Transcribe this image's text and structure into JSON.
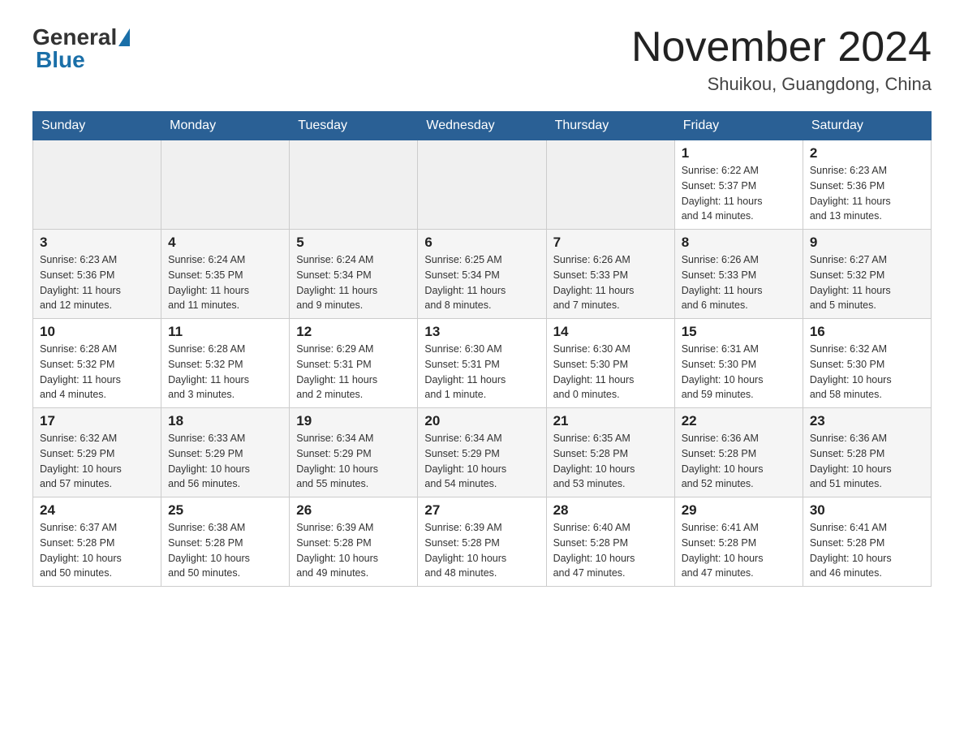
{
  "header": {
    "logo_general": "General",
    "logo_blue": "Blue",
    "month_title": "November 2024",
    "location": "Shuikou, Guangdong, China"
  },
  "days_of_week": [
    "Sunday",
    "Monday",
    "Tuesday",
    "Wednesday",
    "Thursday",
    "Friday",
    "Saturday"
  ],
  "weeks": [
    [
      {
        "day": "",
        "info": ""
      },
      {
        "day": "",
        "info": ""
      },
      {
        "day": "",
        "info": ""
      },
      {
        "day": "",
        "info": ""
      },
      {
        "day": "",
        "info": ""
      },
      {
        "day": "1",
        "info": "Sunrise: 6:22 AM\nSunset: 5:37 PM\nDaylight: 11 hours\nand 14 minutes."
      },
      {
        "day": "2",
        "info": "Sunrise: 6:23 AM\nSunset: 5:36 PM\nDaylight: 11 hours\nand 13 minutes."
      }
    ],
    [
      {
        "day": "3",
        "info": "Sunrise: 6:23 AM\nSunset: 5:36 PM\nDaylight: 11 hours\nand 12 minutes."
      },
      {
        "day": "4",
        "info": "Sunrise: 6:24 AM\nSunset: 5:35 PM\nDaylight: 11 hours\nand 11 minutes."
      },
      {
        "day": "5",
        "info": "Sunrise: 6:24 AM\nSunset: 5:34 PM\nDaylight: 11 hours\nand 9 minutes."
      },
      {
        "day": "6",
        "info": "Sunrise: 6:25 AM\nSunset: 5:34 PM\nDaylight: 11 hours\nand 8 minutes."
      },
      {
        "day": "7",
        "info": "Sunrise: 6:26 AM\nSunset: 5:33 PM\nDaylight: 11 hours\nand 7 minutes."
      },
      {
        "day": "8",
        "info": "Sunrise: 6:26 AM\nSunset: 5:33 PM\nDaylight: 11 hours\nand 6 minutes."
      },
      {
        "day": "9",
        "info": "Sunrise: 6:27 AM\nSunset: 5:32 PM\nDaylight: 11 hours\nand 5 minutes."
      }
    ],
    [
      {
        "day": "10",
        "info": "Sunrise: 6:28 AM\nSunset: 5:32 PM\nDaylight: 11 hours\nand 4 minutes."
      },
      {
        "day": "11",
        "info": "Sunrise: 6:28 AM\nSunset: 5:32 PM\nDaylight: 11 hours\nand 3 minutes."
      },
      {
        "day": "12",
        "info": "Sunrise: 6:29 AM\nSunset: 5:31 PM\nDaylight: 11 hours\nand 2 minutes."
      },
      {
        "day": "13",
        "info": "Sunrise: 6:30 AM\nSunset: 5:31 PM\nDaylight: 11 hours\nand 1 minute."
      },
      {
        "day": "14",
        "info": "Sunrise: 6:30 AM\nSunset: 5:30 PM\nDaylight: 11 hours\nand 0 minutes."
      },
      {
        "day": "15",
        "info": "Sunrise: 6:31 AM\nSunset: 5:30 PM\nDaylight: 10 hours\nand 59 minutes."
      },
      {
        "day": "16",
        "info": "Sunrise: 6:32 AM\nSunset: 5:30 PM\nDaylight: 10 hours\nand 58 minutes."
      }
    ],
    [
      {
        "day": "17",
        "info": "Sunrise: 6:32 AM\nSunset: 5:29 PM\nDaylight: 10 hours\nand 57 minutes."
      },
      {
        "day": "18",
        "info": "Sunrise: 6:33 AM\nSunset: 5:29 PM\nDaylight: 10 hours\nand 56 minutes."
      },
      {
        "day": "19",
        "info": "Sunrise: 6:34 AM\nSunset: 5:29 PM\nDaylight: 10 hours\nand 55 minutes."
      },
      {
        "day": "20",
        "info": "Sunrise: 6:34 AM\nSunset: 5:29 PM\nDaylight: 10 hours\nand 54 minutes."
      },
      {
        "day": "21",
        "info": "Sunrise: 6:35 AM\nSunset: 5:28 PM\nDaylight: 10 hours\nand 53 minutes."
      },
      {
        "day": "22",
        "info": "Sunrise: 6:36 AM\nSunset: 5:28 PM\nDaylight: 10 hours\nand 52 minutes."
      },
      {
        "day": "23",
        "info": "Sunrise: 6:36 AM\nSunset: 5:28 PM\nDaylight: 10 hours\nand 51 minutes."
      }
    ],
    [
      {
        "day": "24",
        "info": "Sunrise: 6:37 AM\nSunset: 5:28 PM\nDaylight: 10 hours\nand 50 minutes."
      },
      {
        "day": "25",
        "info": "Sunrise: 6:38 AM\nSunset: 5:28 PM\nDaylight: 10 hours\nand 50 minutes."
      },
      {
        "day": "26",
        "info": "Sunrise: 6:39 AM\nSunset: 5:28 PM\nDaylight: 10 hours\nand 49 minutes."
      },
      {
        "day": "27",
        "info": "Sunrise: 6:39 AM\nSunset: 5:28 PM\nDaylight: 10 hours\nand 48 minutes."
      },
      {
        "day": "28",
        "info": "Sunrise: 6:40 AM\nSunset: 5:28 PM\nDaylight: 10 hours\nand 47 minutes."
      },
      {
        "day": "29",
        "info": "Sunrise: 6:41 AM\nSunset: 5:28 PM\nDaylight: 10 hours\nand 47 minutes."
      },
      {
        "day": "30",
        "info": "Sunrise: 6:41 AM\nSunset: 5:28 PM\nDaylight: 10 hours\nand 46 minutes."
      }
    ]
  ]
}
